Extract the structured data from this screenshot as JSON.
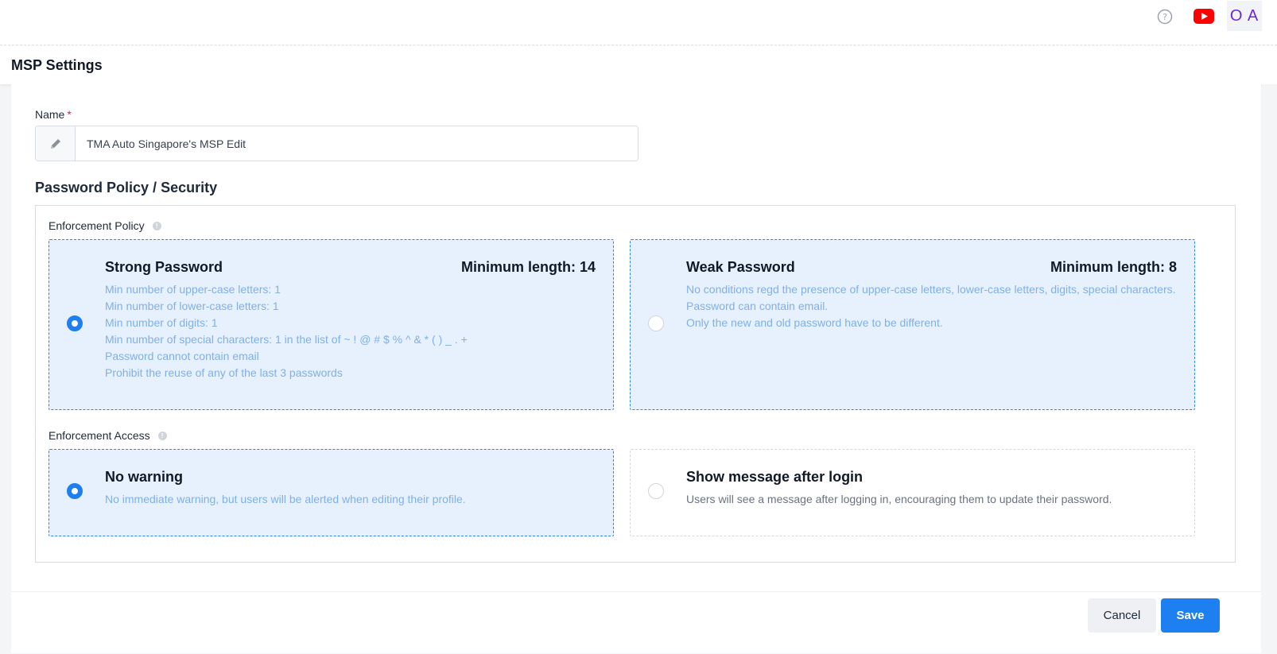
{
  "topbar": {
    "help_icon": "question-circle-icon",
    "youtube_icon": "youtube-icon",
    "avatar_initials": "O A"
  },
  "header": {
    "title": "MSP Settings"
  },
  "form": {
    "name_label": "Name",
    "name_required_mark": "*",
    "name_value": "TMA Auto Singapore's MSP Edit",
    "name_icon": "pencil-icon"
  },
  "security": {
    "section_title": "Password Policy / Security",
    "enforcement_policy_label": "Enforcement Policy",
    "enforcement_access_label": "Enforcement Access",
    "policies": [
      {
        "title": "Strong Password",
        "min_length": "Minimum length: 14",
        "selected": true,
        "lines": [
          "Min number of upper-case letters: 1",
          "Min number of lower-case letters: 1",
          "Min number of digits: 1",
          "Min number of special characters: 1 in the list of ~ ! @ # $ % ^ & * ( ) _ . +",
          "Password cannot contain email",
          "Prohibit the reuse of any of the last 3 passwords"
        ]
      },
      {
        "title": "Weak Password",
        "min_length": "Minimum length: 8",
        "selected": false,
        "lines": [
          "No conditions regd the presence of upper-case letters, lower-case letters, digits, special characters.",
          "Password can contain email.",
          "Only the new and old password have to be different."
        ]
      }
    ],
    "access": [
      {
        "title": "No warning",
        "description": "No immediate warning, but users will be alerted when editing their profile.",
        "selected": true
      },
      {
        "title": "Show message after login",
        "description": "Users will see a message after logging in, encouraging them to update their password.",
        "selected": false
      }
    ]
  },
  "footer": {
    "cancel_label": "Cancel",
    "save_label": "Save"
  },
  "colors": {
    "accent": "#1e80f0",
    "selected_bg": "#e7f1fd",
    "avatar_text": "#6d28d9",
    "youtube": "#ff0000"
  }
}
